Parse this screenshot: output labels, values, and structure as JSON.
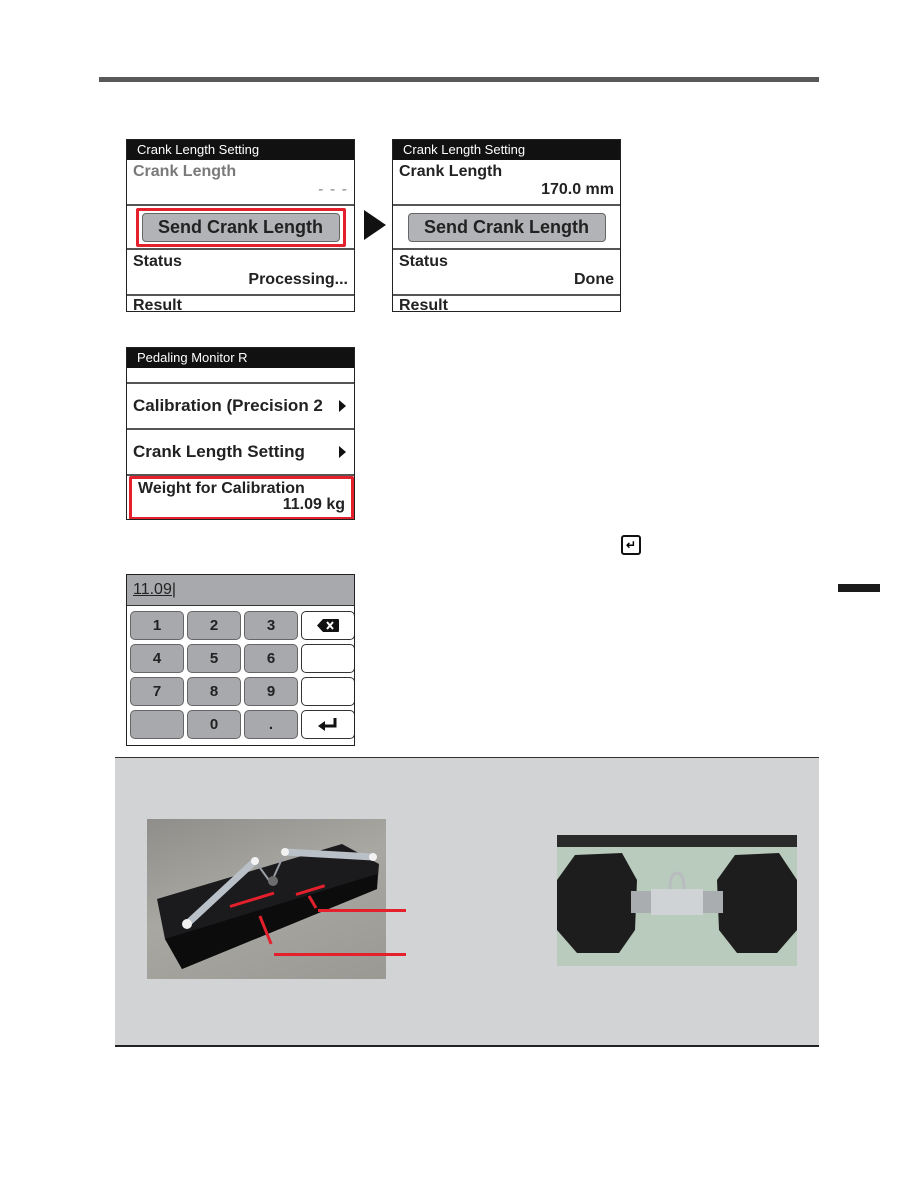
{
  "screens": {
    "crank_before": {
      "title": "Crank Length Setting",
      "crank_length_label": "Crank Length",
      "crank_length_value": "- - -",
      "send_button": "Send Crank Length",
      "status_label": "Status",
      "status_value": "Processing...",
      "result_label": "Result"
    },
    "crank_after": {
      "title": "Crank Length Setting",
      "crank_length_label": "Crank Length",
      "crank_length_value": "170.0 mm",
      "send_button": "Send Crank Length",
      "status_label": "Status",
      "status_value": "Done",
      "result_label": "Result"
    },
    "pedaling_menu": {
      "title": "Pedaling Monitor R",
      "items": [
        {
          "label": "Calibration (Precision 2"
        },
        {
          "label": "Crank Length Setting"
        }
      ],
      "weight_label": "Weight for Calibration",
      "weight_value": "11.09 kg"
    },
    "keypad": {
      "input_value": "11.09",
      "keys": [
        "1",
        "2",
        "3",
        "backspace",
        "4",
        "5",
        "6",
        "",
        "7",
        "8",
        "9",
        "",
        "",
        "0",
        ".",
        "enter"
      ]
    }
  },
  "icons": {
    "transition": "arrow-right-icon",
    "enter": "enter-key-icon",
    "backspace": "backspace-icon"
  },
  "colors": {
    "highlight": "#e3202c",
    "note_bg": "#d1d3d4",
    "key_gray": "#a7a9ac"
  }
}
